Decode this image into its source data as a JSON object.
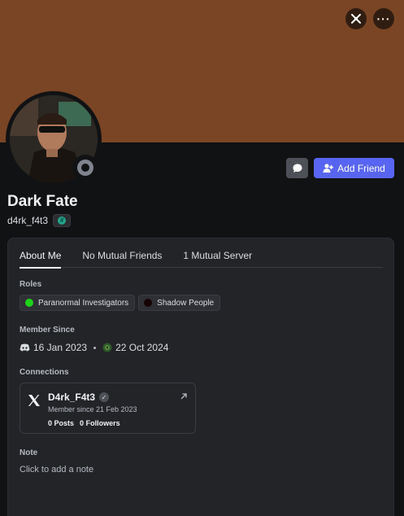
{
  "banner": {
    "color": "#7a4524"
  },
  "top_actions": {
    "nitro_icon": "nitro-wumpus-icon",
    "more_icon": "more-dots-icon",
    "more_label": "···"
  },
  "avatar": {
    "status": "offline"
  },
  "header_actions": {
    "message_icon": "chat-bubble-icon",
    "add_friend_label": "Add Friend",
    "accent": "#5865f2"
  },
  "profile": {
    "display_name": "Dark Fate",
    "username": "d4rk_f4t3"
  },
  "tabs": [
    {
      "label": "About Me",
      "active": true
    },
    {
      "label": "No Mutual Friends",
      "active": false
    },
    {
      "label": "1 Mutual Server",
      "active": false
    }
  ],
  "roles_section": {
    "title": "Roles",
    "roles": [
      {
        "name": "Paranormal Investigators",
        "color": "#1ed31a"
      },
      {
        "name": "Shadow People",
        "color": "#170404"
      }
    ]
  },
  "member_since": {
    "title": "Member Since",
    "discord_date": "16 Jan 2023",
    "server_date": "22 Oct 2024"
  },
  "connections": {
    "title": "Connections",
    "items": [
      {
        "service_icon": "x-logo-icon",
        "name": "D4rk_F4t3",
        "since": "Member since 21 Feb 2023",
        "posts_count": "0",
        "posts_label": "Posts",
        "followers_count": "0",
        "followers_label": "Followers"
      }
    ]
  },
  "note": {
    "title": "Note",
    "placeholder": "Click to add a note"
  }
}
